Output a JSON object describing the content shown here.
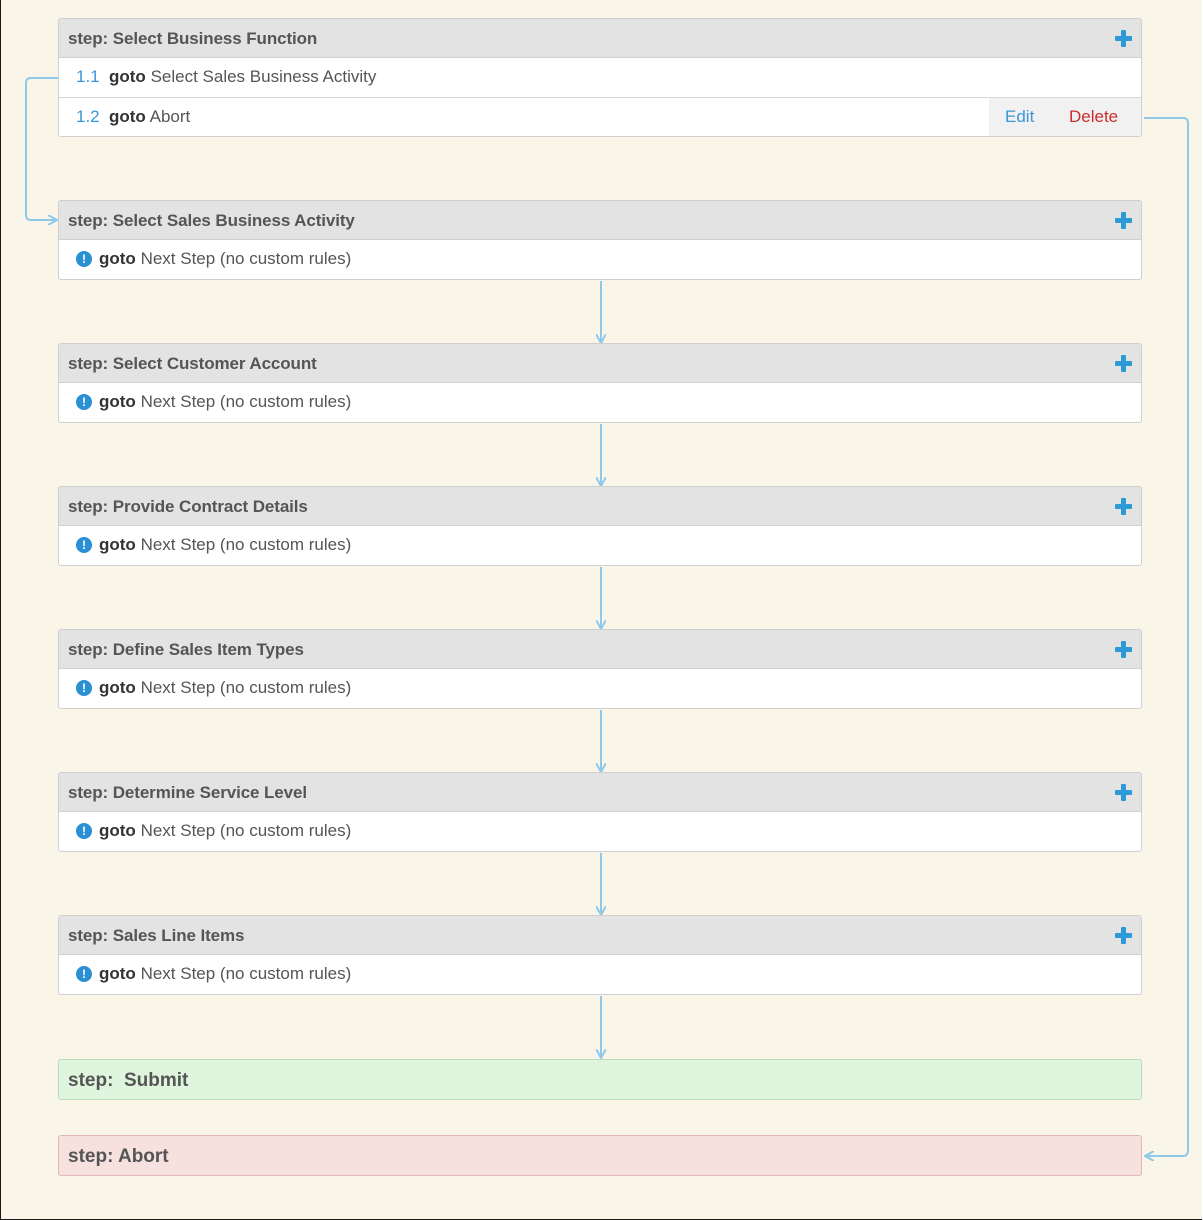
{
  "steps": [
    {
      "title": "step: Select Business Function",
      "rules": [
        {
          "num": "1.1",
          "keyword": "goto",
          "target": "Select Sales Business Activity"
        },
        {
          "num": "1.2",
          "keyword": "goto",
          "target": "Abort",
          "edit_label": "Edit",
          "delete_label": "Delete"
        }
      ]
    },
    {
      "title": "step: Select Sales Business Activity",
      "default_keyword": "goto",
      "default_text": "Next Step (no custom rules)"
    },
    {
      "title": "step: Select Customer Account",
      "default_keyword": "goto",
      "default_text": "Next Step (no custom rules)"
    },
    {
      "title": "step: Provide Contract Details",
      "default_keyword": "goto",
      "default_text": "Next Step (no custom rules)"
    },
    {
      "title": "step: Define Sales Item Types",
      "default_keyword": "goto",
      "default_text": "Next Step (no custom rules)"
    },
    {
      "title": "step: Determine Service Level",
      "default_keyword": "goto",
      "default_text": "Next Step (no custom rules)"
    },
    {
      "title": "step: Sales Line Items",
      "default_keyword": "goto",
      "default_text": "Next Step (no custom rules)"
    }
  ],
  "end_steps": {
    "submit": "step:  Submit",
    "abort": "step: Abort"
  },
  "icons": {
    "add": "plus-icon",
    "info": "info-icon",
    "info_glyph": "!"
  },
  "colors": {
    "accent_blue": "#2b9ad6",
    "arrow_blue": "#8ec8ea",
    "delete_red": "#cc2d2d",
    "submit_bg": "#dff5de",
    "abort_bg": "#f7e1df"
  }
}
